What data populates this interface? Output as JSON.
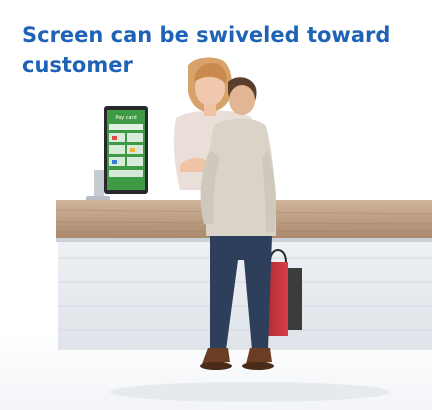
{
  "caption": {
    "text": "Screen can be swiveled toward customer"
  },
  "scene": {
    "kiosk_screen": {
      "header_text": "Pay card"
    }
  },
  "colors": {
    "caption": "#1f63b6",
    "screen_green": "#3f9a45",
    "counter_wood": "#b9977c",
    "bag_red": "#c9353b"
  }
}
